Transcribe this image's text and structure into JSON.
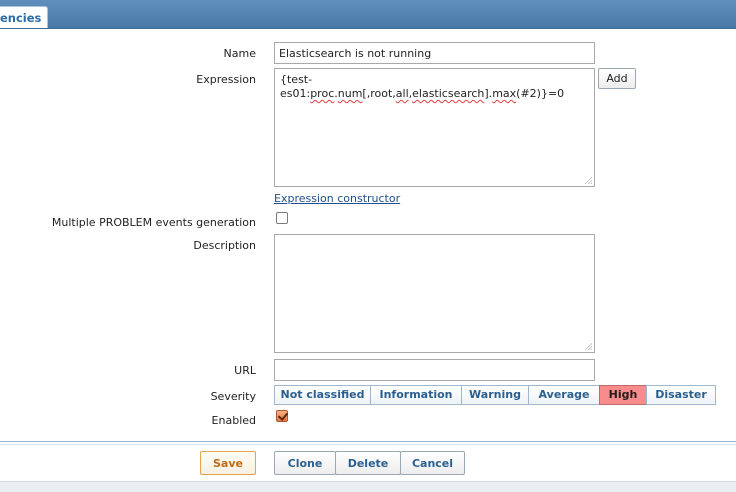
{
  "tab": {
    "label": "encies"
  },
  "form": {
    "name": {
      "label": "Name",
      "value": "Elasticsearch is not running"
    },
    "expression": {
      "label": "Expression",
      "parts": [
        "{test-es01:",
        "proc",
        ".",
        "num",
        "[,root,",
        "all",
        ",",
        "elasticsearch",
        "].",
        "max",
        "(#2)}=0"
      ],
      "add_label": "Add",
      "constructor_link": "Expression constructor"
    },
    "multiple_events": {
      "label": "Multiple PROBLEM events generation",
      "checked": false
    },
    "description": {
      "label": "Description",
      "value": ""
    },
    "url": {
      "label": "URL",
      "value": ""
    },
    "severity": {
      "label": "Severity",
      "options": [
        "Not classified",
        "Information",
        "Warning",
        "Average",
        "High",
        "Disaster"
      ],
      "selected": "High",
      "selected_color": "#f88c8c"
    },
    "enabled": {
      "label": "Enabled",
      "checked": true
    }
  },
  "actions": {
    "save": "Save",
    "clone": "Clone",
    "delete": "Delete",
    "cancel": "Cancel"
  }
}
